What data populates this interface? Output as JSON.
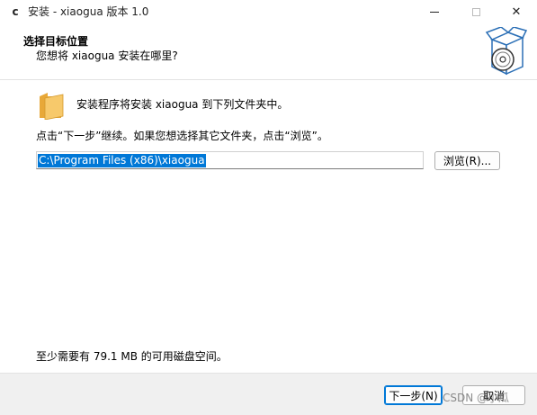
{
  "window": {
    "app_icon_glyph": "c",
    "title": "安装 - xiaogua 版本 1.0",
    "min_icon": "minimize-icon",
    "max_icon": "maximize-icon",
    "close_glyph": "✕"
  },
  "header": {
    "title": "选择目标位置",
    "subtitle": "您想将 xiaogua 安装在哪里?",
    "graphic_icon": "installer-box-disc-icon"
  },
  "body": {
    "folder_icon": "folder-icon",
    "intro": "安装程序将安装 xiaogua 到下列文件夹中。",
    "instruction": "点击“下一步”继续。如果您想选择其它文件夹，点击“浏览”。",
    "path_value": "C:\\Program Files (x86)\\xiaogua",
    "browse_label": "浏览(R)...",
    "disk_space": "至少需要有 79.1 MB 的可用磁盘空间。"
  },
  "footer": {
    "next_label": "下一步(N)",
    "cancel_label": "取消"
  },
  "watermark": "CSDN @小瓜",
  "colors": {
    "selection": "#0078d7",
    "footer_bg": "#f0f0f0",
    "default_button_border": "#0078d7"
  }
}
